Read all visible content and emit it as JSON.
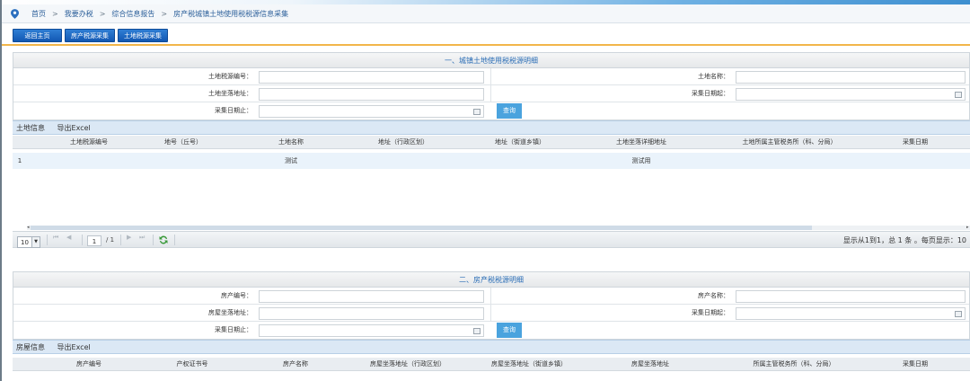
{
  "breadcrumb": {
    "items": [
      "首页",
      "我要办税",
      "综合信息报告",
      "房产税城镇土地使用税税源信息采集"
    ],
    "separator": ">"
  },
  "buttons": {
    "home": "返回主页",
    "house_collect": "房产税源采集",
    "land_collect": "土地税源采集"
  },
  "land_section": {
    "title": "一、城镇土地使用税税源明细",
    "fields": {
      "source_no": "土地税源编号：",
      "name": "土地名称：",
      "location": "土地坐落地址：",
      "date_from": "采集日期起：",
      "date_to": "采集日期止："
    },
    "query_button": "查询",
    "tab_info": "土地信息",
    "tab_export": "导出Excel",
    "columns": [
      "土地税源编号",
      "地号（丘号）",
      "土地名称",
      "地址（行政区划）",
      "地址（街道乡镇）",
      "土地坐落详细地址",
      "土地所属主管税务所（科、分局）",
      "采集日期"
    ],
    "rows": [
      {
        "index": "1",
        "source_no": "",
        "lot_no": "",
        "name": "测试",
        "addr_admin": "",
        "addr_street": "",
        "detail_addr": "测试用",
        "tax_office": "",
        "date": ""
      }
    ]
  },
  "pager": {
    "page_size": "10",
    "first": "⏮",
    "prev": "◀",
    "current_page": "1",
    "total_pages": "/ 1",
    "next": "▶",
    "last": "⏭",
    "info": "显示从1到1，总 1 条 。每页显示：10"
  },
  "house_section": {
    "title": "二、房产税税源明细",
    "fields": {
      "house_no": "房产编号：",
      "name": "房产名称：",
      "location": "房屋坐落地址：",
      "date_from": "采集日期起：",
      "date_to": "采集日期止："
    },
    "query_button": "查询",
    "tab_info": "房屋信息",
    "tab_export": "导出Excel",
    "columns": [
      "房产编号",
      "产权证书号",
      "房产名称",
      "房屋坐落地址（行政区划）",
      "房屋坐落地址（街道乡镇）",
      "房屋坐落地址",
      "所属主管税务所（科、分局）",
      "采集日期"
    ]
  },
  "colors": {
    "accent_blue": "#1a66c0",
    "title_blue": "#2a6db5",
    "orange_line": "#f2b64a",
    "query_blue": "#4aa3de"
  }
}
